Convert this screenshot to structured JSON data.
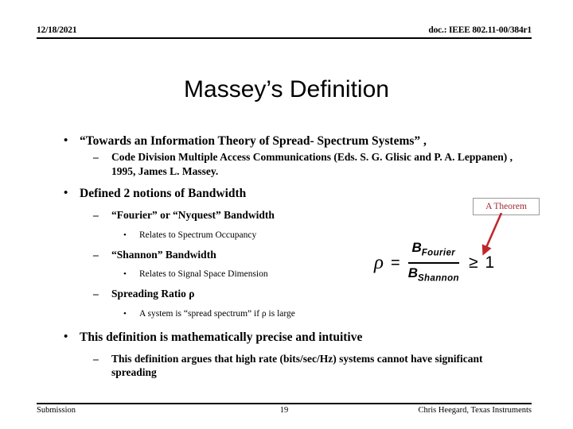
{
  "header": {
    "date": "12/18/2021",
    "doc_reference": "doc.: IEEE 802.11-00/384r1"
  },
  "title": "Massey’s Definition",
  "body": {
    "bullets": [
      {
        "level": 1,
        "marker": "•",
        "text": "“Towards an Information Theory of Spread- Spectrum Systems” ,"
      },
      {
        "level": 2,
        "marker": "–",
        "text": "Code Division Multiple Access Communications (Eds. S. G. Glisic and P. A. Leppanen) , 1995, James L. Massey."
      },
      {
        "level": 1,
        "marker": "•",
        "text": "Defined 2 notions of Bandwidth"
      },
      {
        "level": 2,
        "marker": "–",
        "text": "“Fourier” or “Nyquest” Bandwidth"
      },
      {
        "level": 3,
        "marker": "•",
        "text": "Relates to Spectrum Occupancy"
      },
      {
        "level": 2,
        "marker": "–",
        "text": "“Shannon” Bandwidth"
      },
      {
        "level": 3,
        "marker": "•",
        "text": "Relates to Signal Space Dimension"
      },
      {
        "level": 2,
        "marker": "–",
        "text": "Spreading Ratio ρ"
      },
      {
        "level": 3,
        "marker": "•",
        "text": "A system is “spread spectrum” if ρ is large"
      },
      {
        "level": 1,
        "marker": "•",
        "text": "This definition is mathematically precise and intuitive"
      },
      {
        "level": 2,
        "marker": "–",
        "text": "This definition argues that high rate (bits/sec/Hz) systems cannot have significant spreading"
      }
    ]
  },
  "callout": {
    "label": "A Theorem",
    "text_color": "#a02832",
    "border_color": "#9a9a9a",
    "arrow_color": "#c0272d"
  },
  "equation": {
    "rho": "ρ",
    "equals": "=",
    "numerator_base": "B",
    "numerator_sub": "Fourier",
    "denominator_base": "B",
    "denominator_sub": "Shannon",
    "relation": "≥",
    "right_side": "1"
  },
  "footer": {
    "left": "Submission",
    "page_number": "19",
    "right": "Chris Heegard, Texas Instruments"
  }
}
